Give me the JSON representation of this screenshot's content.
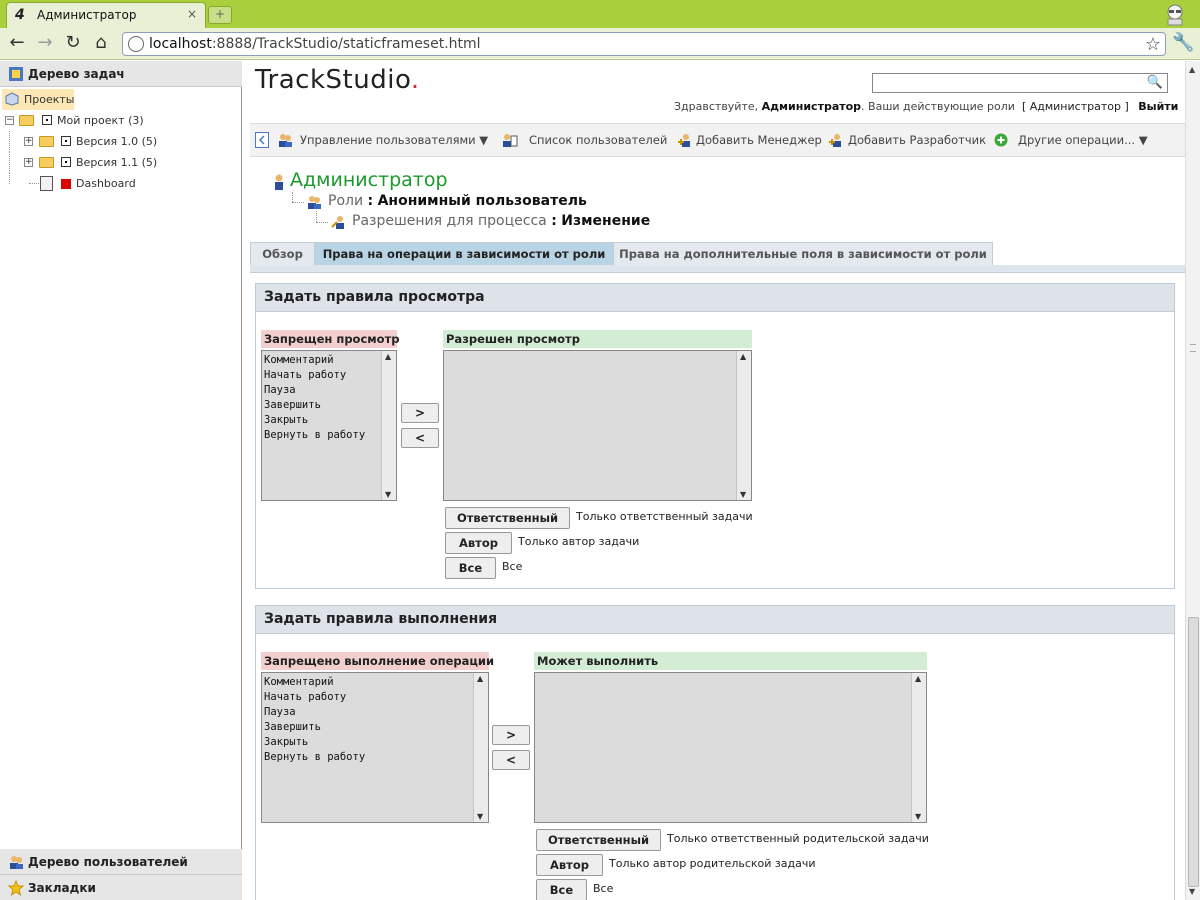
{
  "browser": {
    "tab_title": "Администратор",
    "tab_close": "×",
    "new_tab": "+",
    "url_host": "localhost",
    "url_rest": ":8888/TrackStudio/staticframeset.html",
    "back": "←",
    "forward": "→",
    "reload": "↻",
    "home": "⌂",
    "star": "☆",
    "wrench": "🔧"
  },
  "left_panel": {
    "task_tree_title": "Дерево задач",
    "tree": {
      "root": "Проекты",
      "project": "Мой проект (3)",
      "version1": "Версия 1.0 (5)",
      "version2": "Версия 1.1 (5)",
      "dashboard": "Dashboard"
    },
    "users_tree_title": "Дерево пользователей",
    "bookmarks_title": "Закладки"
  },
  "header": {
    "logo": "TrackStudio",
    "logo_dot": ".",
    "search_placeholder": "",
    "greeting_prefix": "Здравствуйте,",
    "greeting_user": "Администратор",
    "greeting_suffix": ". Ваши действующие роли",
    "active_role": "[ Администратор ]",
    "logout": "Выйти"
  },
  "operations_toolbar": {
    "manage_users": "Управление пользователями",
    "user_list": "Список пользователей",
    "add_manager": "Добавить Менеджер",
    "add_developer": "Добавить Разработчик",
    "other_operations": "Другие операции..."
  },
  "breadcrumbs": {
    "admin": "Администратор",
    "roles_key": "Роли",
    "roles_val": "Анонимный пользователь",
    "perm_key": "Разрешения для процесса",
    "perm_val": "Изменение",
    "sep": ":"
  },
  "tabs": {
    "overview": "Обзор",
    "role_operations": "Права на операции в зависимости от роли",
    "role_fields": "Права на дополнительные поля в зависимости от роли"
  },
  "view_rules": {
    "title": "Задать правила просмотра",
    "denied_label": "Запрещен просмотр",
    "allowed_label": "Разрешен просмотр",
    "denied_items": [
      "Комментарий",
      "Начать работу",
      "Пауза",
      "Завершить",
      "Закрыть",
      "Вернуть в работу"
    ],
    "move_right": ">",
    "move_left": "<",
    "responsible_btn": "Ответственный",
    "responsible_txt": "Только ответственный задачи",
    "author_btn": "Автор",
    "author_txt": "Только автор задачи",
    "all_btn": "Все",
    "all_txt": "Все"
  },
  "exec_rules": {
    "title": "Задать правила выполнения",
    "denied_label": "Запрещено выполнение операции",
    "allowed_label": "Может выполнить",
    "denied_items": [
      "Комментарий",
      "Начать работу",
      "Пауза",
      "Завершить",
      "Закрыть",
      "Вернуть в работу"
    ],
    "move_right": ">",
    "move_left": "<",
    "responsible_btn": "Ответственный",
    "responsible_txt": "Только ответственный родительской задачи",
    "author_btn": "Автор",
    "author_txt": "Только автор родительской задачи",
    "all_btn": "Все",
    "all_txt": "Все"
  },
  "colors": {
    "chrome_green": "#a9cf3c",
    "admin_green": "#1a9a2a",
    "denied_bg": "#f3cfcf",
    "allowed_bg": "#d3ecd4",
    "active_tab": "#b8d3e4"
  }
}
